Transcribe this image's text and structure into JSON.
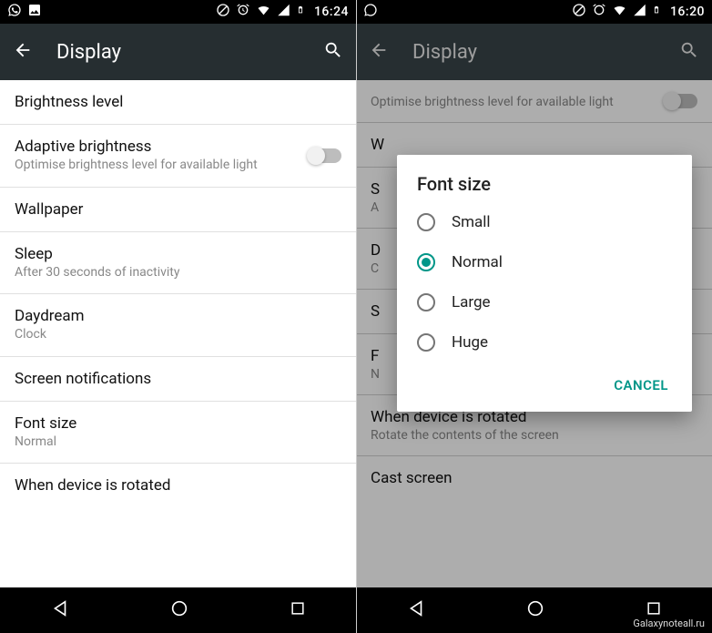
{
  "left": {
    "statusbar": {
      "time": "16:24"
    },
    "appbar": {
      "title": "Display"
    },
    "items": [
      {
        "title": "Brightness level",
        "sub": ""
      },
      {
        "title": "Adaptive brightness",
        "sub": "Optimise brightness level for available light",
        "toggle": true
      },
      {
        "title": "Wallpaper",
        "sub": ""
      },
      {
        "title": "Sleep",
        "sub": "After 30 seconds of inactivity"
      },
      {
        "title": "Daydream",
        "sub": "Clock"
      },
      {
        "title": "Screen notifications",
        "sub": ""
      },
      {
        "title": "Font size",
        "sub": "Normal"
      },
      {
        "title": "When device is rotated",
        "sub": ""
      }
    ]
  },
  "right": {
    "statusbar": {
      "time": "16:20"
    },
    "appbar": {
      "title": "Display"
    },
    "bg_items": [
      {
        "title": "",
        "sub": "Optimise brightness level for available light"
      },
      {
        "title": "W",
        "sub": ""
      },
      {
        "title": "S",
        "sub": "A"
      },
      {
        "title": "D",
        "sub": "C"
      },
      {
        "title": "S",
        "sub": ""
      },
      {
        "title": "F",
        "sub": "N"
      },
      {
        "title": "When device is rotated",
        "sub": "Rotate the contents of the screen"
      },
      {
        "title": "Cast screen",
        "sub": ""
      }
    ],
    "dialog": {
      "title": "Font size",
      "options": [
        {
          "label": "Small",
          "selected": false
        },
        {
          "label": "Normal",
          "selected": true
        },
        {
          "label": "Large",
          "selected": false
        },
        {
          "label": "Huge",
          "selected": false
        }
      ],
      "cancel": "CANCEL"
    }
  },
  "watermark": "Galaxynoteall.ru"
}
